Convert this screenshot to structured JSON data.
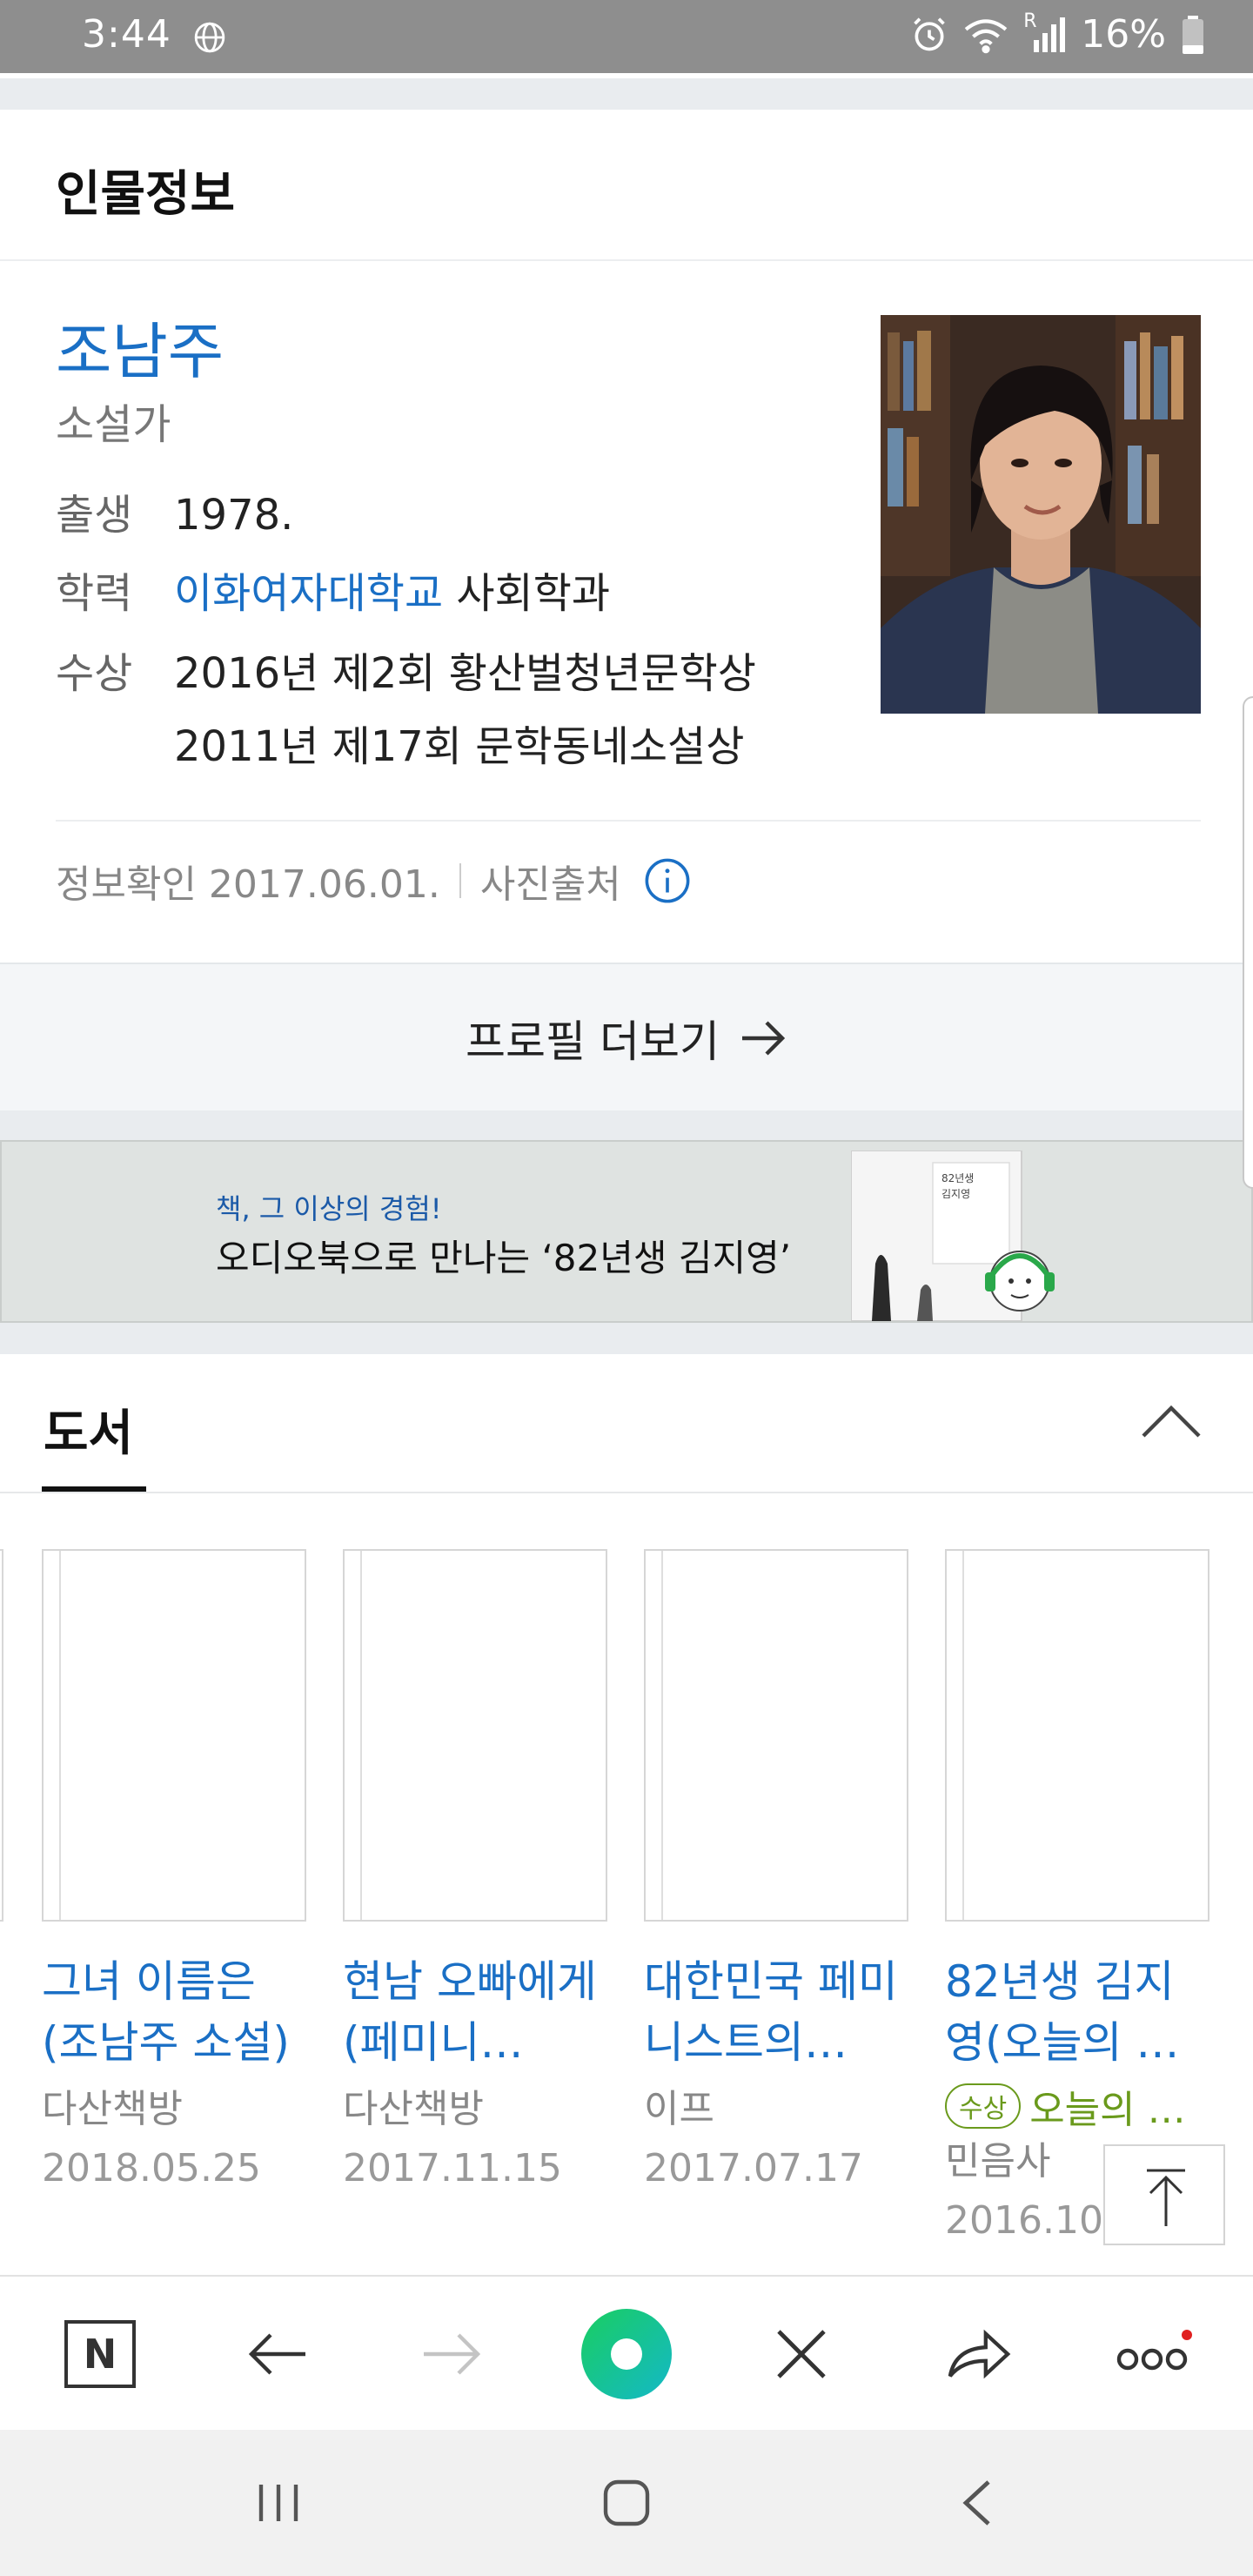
{
  "status_bar": {
    "time": "3:44",
    "battery": "16%",
    "signal_label": "R"
  },
  "profile_section": {
    "title": "인물정보"
  },
  "person": {
    "name": "조남주",
    "occupation": "소설가",
    "birth_label": "출생",
    "birth_value": "1978.",
    "education_label": "학력",
    "education_school": "이화여자대학교",
    "education_major": "사회학과",
    "awards_label": "수상",
    "awards": [
      "2016년 제2회 황산벌청년문학상",
      "2011년 제17회 문학동네소설상"
    ],
    "info_checked": "정보확인 2017.06.01.",
    "photo_source": "사진출처"
  },
  "more_profile": {
    "label": "프로필 더보기"
  },
  "banner": {
    "subtitle": "책, 그 이상의 경험!",
    "title": "오디오북으로 만나는 ‘82년생 김지영’",
    "book_art_text_1": "82년생",
    "book_art_text_2": "김지영"
  },
  "books_section": {
    "tab": "도서"
  },
  "books": [
    {
      "title": "그녀 이름은 (조남주 소설)",
      "publisher": "다산책방",
      "date": "2018.05.25"
    },
    {
      "title": "현남 오빠에게(페미니…",
      "publisher": "다산책방",
      "date": "2017.11.15"
    },
    {
      "title": "대한민국 페미니스트의…",
      "publisher": "이프",
      "date": "2017.07.17"
    },
    {
      "title": "82년생 김지영(오늘의 …",
      "badge": "수상",
      "award": "오늘의 …",
      "publisher": "민음사",
      "date": "2016.10.14"
    }
  ],
  "toolbar": {
    "naver_label": "N"
  },
  "colors": {
    "link": "#1a6fc5",
    "award": "#6a9a1c",
    "green_button": "#19ce60",
    "notification_dot": "#e02020"
  }
}
